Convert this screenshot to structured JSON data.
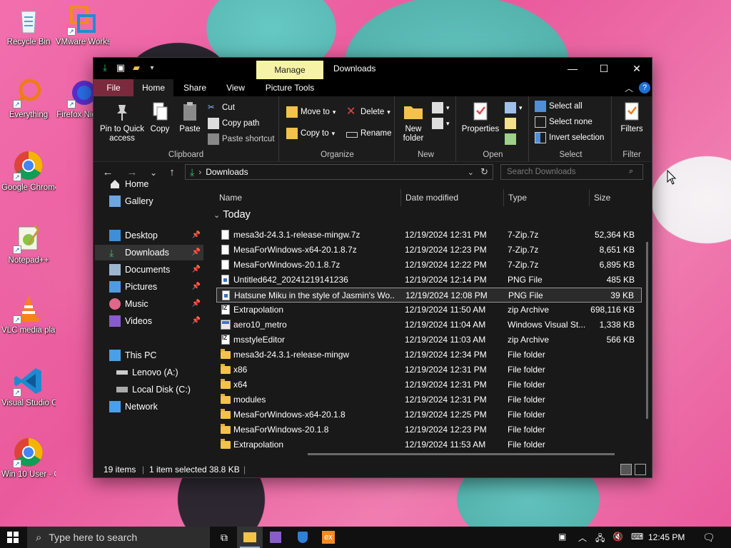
{
  "desktop": {
    "icons": [
      {
        "label": "Recycle Bin"
      },
      {
        "label": "VMware Workstation"
      },
      {
        "label": "Everything"
      },
      {
        "label": "Firefox Nightly"
      },
      {
        "label": "Google Chrome"
      },
      {
        "label": "Notepad++"
      },
      {
        "label": "VLC media player"
      },
      {
        "label": "Visual Studio Code"
      },
      {
        "label": "Win 10 User - Chrome"
      }
    ]
  },
  "window": {
    "title": "Downloads",
    "context_tab": "Manage",
    "tabs": [
      "File",
      "Home",
      "Share",
      "View",
      "Picture Tools"
    ],
    "ribbon": {
      "clipboard": {
        "label": "Clipboard",
        "pin": "Pin to Quick access",
        "copy": "Copy",
        "paste": "Paste",
        "cut": "Cut",
        "copy_path": "Copy path",
        "paste_shortcut": "Paste shortcut"
      },
      "organize": {
        "label": "Organize",
        "move_to": "Move to",
        "copy_to": "Copy to",
        "delete": "Delete",
        "rename": "Rename"
      },
      "new": {
        "label": "New",
        "new_folder": "New folder"
      },
      "open": {
        "label": "Open",
        "properties": "Properties"
      },
      "select": {
        "label": "Select",
        "select_all": "Select all",
        "select_none": "Select none",
        "invert": "Invert selection"
      },
      "filter": {
        "label": "Filter",
        "filters": "Filters"
      }
    },
    "address": {
      "crumb": "Downloads"
    },
    "search": {
      "placeholder": "Search Downloads"
    },
    "nav": {
      "home": "Home",
      "gallery": "Gallery",
      "desktop": "Desktop",
      "downloads": "Downloads",
      "documents": "Documents",
      "pictures": "Pictures",
      "music": "Music",
      "videos": "Videos",
      "this_pc": "This PC",
      "lenovo": "Lenovo (A:)",
      "local_disk": "Local Disk (C:)",
      "network": "Network"
    },
    "columns": {
      "name": "Name",
      "date": "Date modified",
      "type": "Type",
      "size": "Size"
    },
    "group": "Today",
    "files": [
      {
        "name": "mesa3d-24.3.1-release-mingw.7z",
        "date": "12/19/2024 12:31 PM",
        "type": "7-Zip.7z",
        "size": "52,364 KB",
        "icon": "doc"
      },
      {
        "name": "MesaForWindows-x64-20.1.8.7z",
        "date": "12/19/2024 12:23 PM",
        "type": "7-Zip.7z",
        "size": "8,651 KB",
        "icon": "doc"
      },
      {
        "name": "MesaForWindows-20.1.8.7z",
        "date": "12/19/2024 12:22 PM",
        "type": "7-Zip.7z",
        "size": "6,895 KB",
        "icon": "doc"
      },
      {
        "name": "Untitled642_20241219141236",
        "date": "12/19/2024 12:14 PM",
        "type": "PNG File",
        "size": "485 KB",
        "icon": "png"
      },
      {
        "name": "Hatsune Miku in the style of Jasmin's Wo...",
        "date": "12/19/2024 12:08 PM",
        "type": "PNG File",
        "size": "39 KB",
        "icon": "png",
        "selected": true
      },
      {
        "name": "Extrapolation",
        "date": "12/19/2024 11:50 AM",
        "type": "zip Archive",
        "size": "698,116 KB",
        "icon": "zip"
      },
      {
        "name": "aero10_metro",
        "date": "12/19/2024 11:04 AM",
        "type": "Windows Visual St...",
        "size": "1,338 KB",
        "icon": "theme"
      },
      {
        "name": "msstyleEditor",
        "date": "12/19/2024 11:03 AM",
        "type": "zip Archive",
        "size": "566 KB",
        "icon": "zip"
      },
      {
        "name": "mesa3d-24.3.1-release-mingw",
        "date": "12/19/2024 12:34 PM",
        "type": "File folder",
        "size": "",
        "icon": "folder"
      },
      {
        "name": "x86",
        "date": "12/19/2024 12:31 PM",
        "type": "File folder",
        "size": "",
        "icon": "folder"
      },
      {
        "name": "x64",
        "date": "12/19/2024 12:31 PM",
        "type": "File folder",
        "size": "",
        "icon": "folder"
      },
      {
        "name": "modules",
        "date": "12/19/2024 12:31 PM",
        "type": "File folder",
        "size": "",
        "icon": "folder"
      },
      {
        "name": "MesaForWindows-x64-20.1.8",
        "date": "12/19/2024 12:25 PM",
        "type": "File folder",
        "size": "",
        "icon": "folder"
      },
      {
        "name": "MesaForWindows-20.1.8",
        "date": "12/19/2024 12:23 PM",
        "type": "File folder",
        "size": "",
        "icon": "folder"
      },
      {
        "name": "Extrapolation",
        "date": "12/19/2024 11:53 AM",
        "type": "File folder",
        "size": "",
        "icon": "folder"
      }
    ],
    "status": {
      "count": "19 items",
      "selected": "1 item selected",
      "size": "38.8 KB"
    }
  },
  "taskbar": {
    "search_placeholder": "Type here to search",
    "clock": "12:45 PM"
  },
  "colors": {
    "accent": "#7fb1e8",
    "manage_tab": "#f7f3a6",
    "file_tab": "#7a2a3c"
  }
}
